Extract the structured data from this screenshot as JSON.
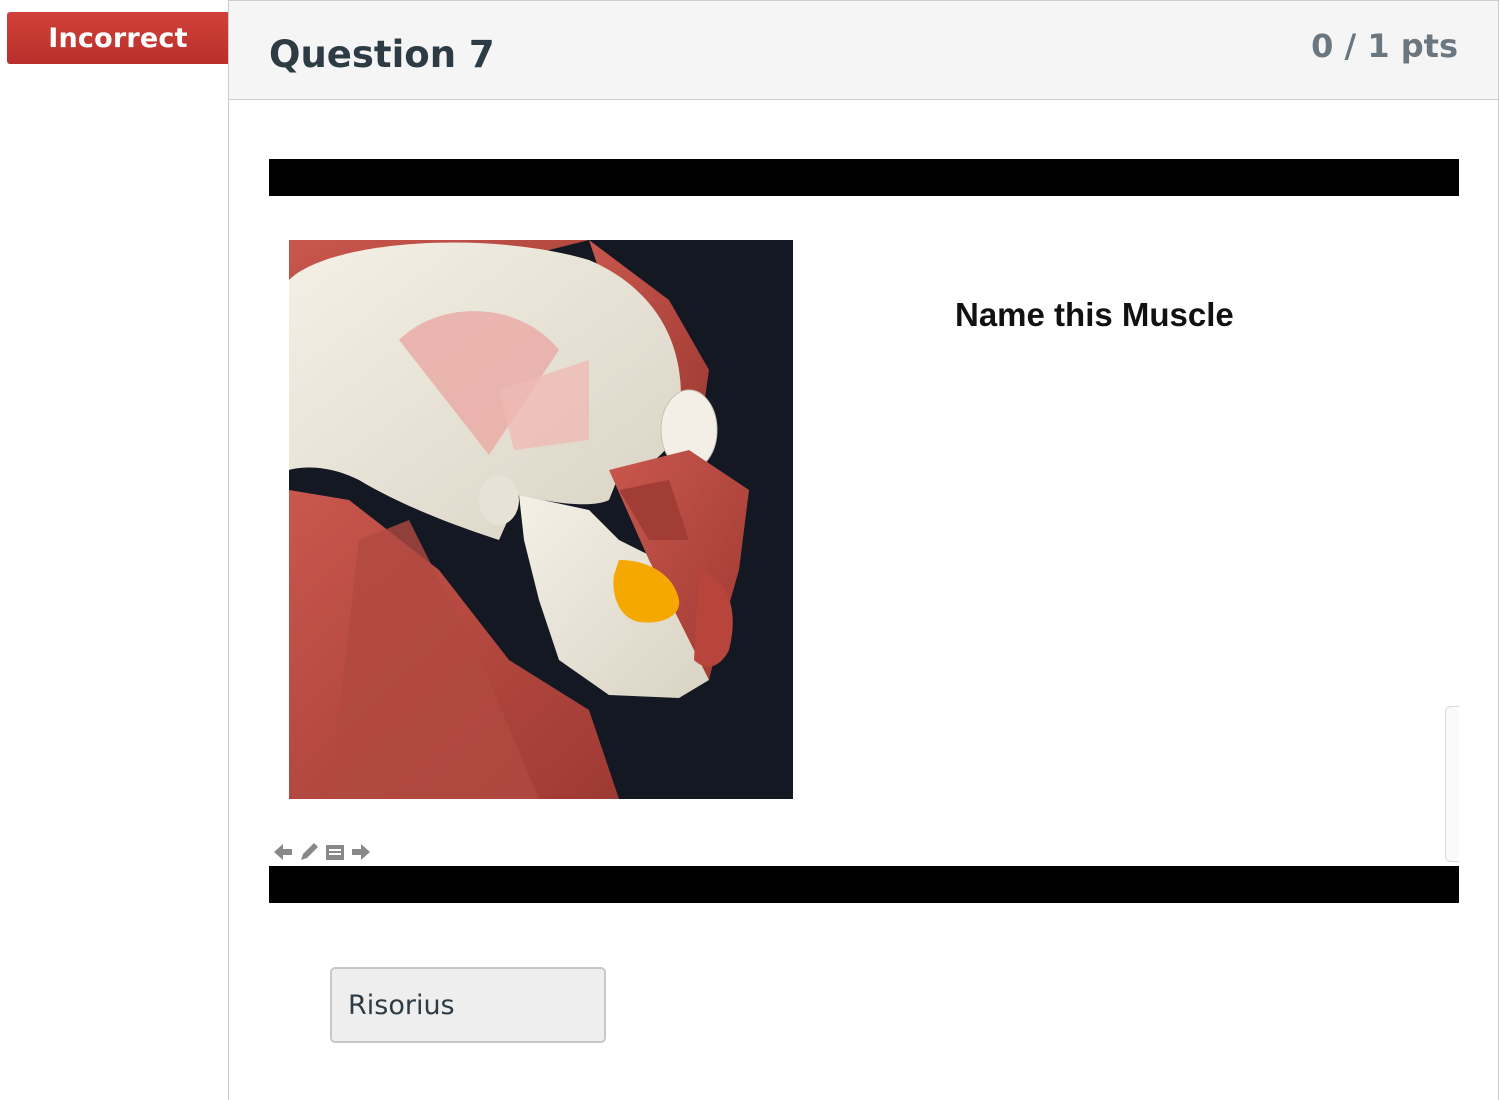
{
  "status": {
    "label": "Incorrect",
    "color": "#c73833"
  },
  "question": {
    "title": "Question 7",
    "points": "0 / 1 pts"
  },
  "slide": {
    "prompt": "Name this Muscle",
    "figure_description_icon": "anatomy-head-muscles-image",
    "nav_icons": [
      "arrow-left-icon",
      "pencil-icon",
      "notes-icon",
      "arrow-right-icon"
    ]
  },
  "answer": {
    "value": "Risorius"
  },
  "colors": {
    "bar": "#000000",
    "muscle": "#b8453c",
    "highlight": "#f5a800",
    "bone": "#ebe6da"
  }
}
